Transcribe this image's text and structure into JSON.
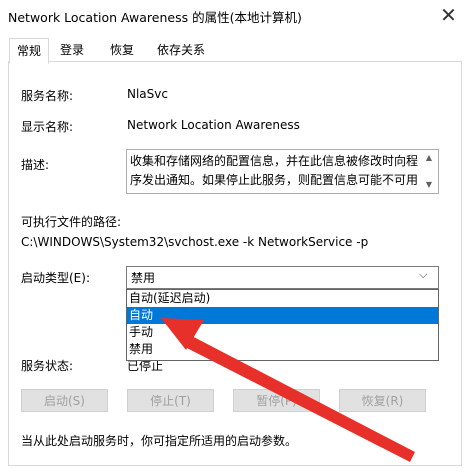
{
  "window": {
    "title": "Network Location Awareness 的属性(本地计算机)",
    "close_glyph": "✕"
  },
  "tabs": [
    {
      "label": "常规"
    },
    {
      "label": "登录"
    },
    {
      "label": "恢复"
    },
    {
      "label": "依存关系"
    }
  ],
  "general": {
    "service_name_label": "服务名称:",
    "service_name_value": "NlaSvc",
    "display_name_label": "显示名称:",
    "display_name_value": "Network Location Awareness",
    "description_label": "描述:",
    "description_value": "收集和存储网络的配置信息，并在此信息被修改时向程序发出通知。如果停止此服务，则配置信息可能不可用",
    "exe_path_label": "可执行文件的路径:",
    "exe_path_value": "C:\\WINDOWS\\System32\\svchost.exe -k NetworkService -p",
    "startup_type_label": "启动类型(E):",
    "startup_type_value": "禁用",
    "startup_options": [
      "自动(延迟启动)",
      "自动",
      "手动",
      "禁用"
    ],
    "highlighted_option": "自动",
    "service_status_label": "服务状态:",
    "service_status_value": "已停止",
    "buttons": {
      "start": "启动(S)",
      "stop": "停止(T)",
      "pause": "暂停(P)",
      "resume": "恢复(R)"
    },
    "hint_text": "当从此处启动服务时，你可指定所适用的启动参数。"
  },
  "annotation": {
    "arrow_color": "#e8302a"
  }
}
